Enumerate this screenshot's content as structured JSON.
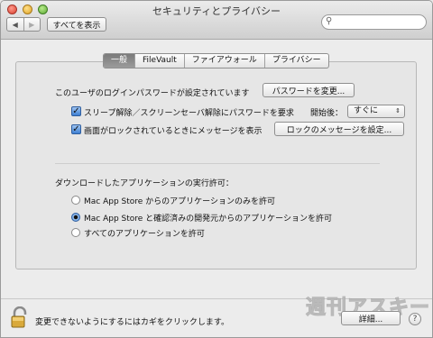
{
  "window": {
    "title": "セキュリティとプライバシー"
  },
  "toolbar": {
    "back_icon": "back-icon",
    "forward_icon": "forward-icon",
    "show_all_label": "すべてを表示",
    "search_placeholder": "",
    "search_value": ""
  },
  "tabs": [
    {
      "label": "一般",
      "active": true
    },
    {
      "label": "FileVault",
      "active": false
    },
    {
      "label": "ファイアウォール",
      "active": false
    },
    {
      "label": "プライバシー",
      "active": false
    }
  ],
  "general": {
    "login_password_text": "このユーザのログインパスワードが設定されています",
    "change_password_button": "パスワードを変更...",
    "require_password_label": "スリープ解除／スクリーンセーバ解除にパスワードを要求",
    "require_password_checked": true,
    "start_after_label": "開始後：",
    "start_after_value": "すぐに",
    "show_message_label": "画面がロックされているときにメッセージを表示",
    "show_message_checked": true,
    "set_lock_message_button": "ロックのメッセージを設定...",
    "download_heading": "ダウンロードしたアプリケーションの実行許可：",
    "download_options": [
      {
        "label": "Mac App Store からのアプリケーションのみを許可",
        "selected": false
      },
      {
        "label": "Mac App Store と確認済みの開発元からのアプリケーションを許可",
        "selected": true
      },
      {
        "label": "すべてのアプリケーションを許可",
        "selected": false
      }
    ]
  },
  "footer": {
    "lock_text": "変更できないようにするにはカギをクリックします。",
    "details_button": "詳細...",
    "help_label": "?",
    "watermark": "週刊アスキー"
  }
}
